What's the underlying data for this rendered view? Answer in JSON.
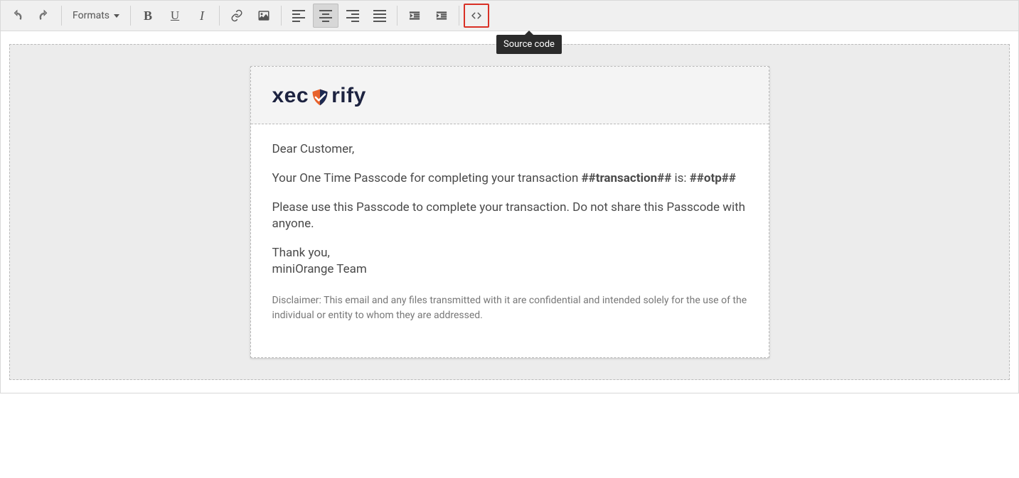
{
  "toolbar": {
    "formats_label": "Formats",
    "tooltip": "Source code"
  },
  "logo": {
    "part1": "xec",
    "part2": "rify"
  },
  "email": {
    "greeting": "Dear Customer,",
    "line1_a": "Your One Time Passcode for completing your transaction ",
    "line1_b": "##transaction##",
    "line1_c": " is: ",
    "line1_d": "##otp##",
    "line2": "Please use this Passcode to complete your transaction. Do not share this Passcode with anyone.",
    "thanks1": "Thank you,",
    "thanks2": "miniOrange Team",
    "disclaimer": "Disclaimer: This email and any files transmitted with it are confidential and intended solely for the use of the individual or entity to whom they are addressed."
  }
}
